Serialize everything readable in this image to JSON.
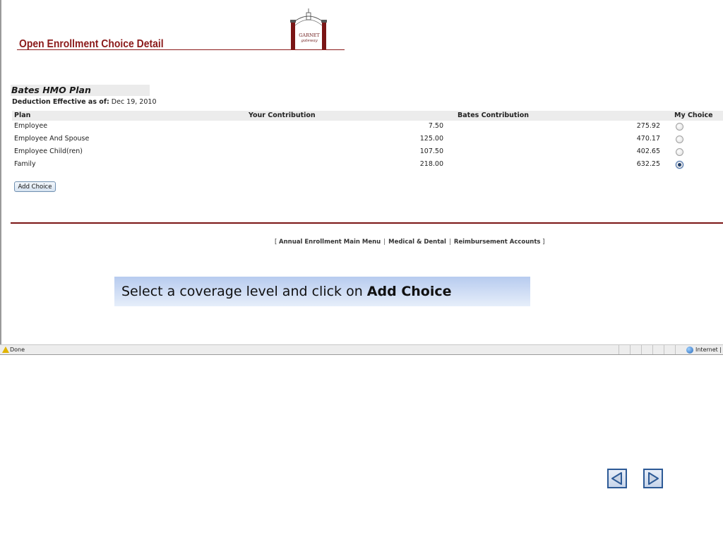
{
  "page": {
    "title": "Open Enrollment Choice Detail",
    "logo_text": "GARNET",
    "logo_sub": "gateway"
  },
  "plan": {
    "name": "Bates HMO Plan",
    "effective_label": "Deduction Effective as of:",
    "effective_date": "Dec 19, 2010",
    "columns": {
      "plan": "Plan",
      "your_contribution": "Your Contribution",
      "bates_contribution": "Bates Contribution",
      "my_choice": "My Choice"
    },
    "rows": [
      {
        "plan": "Employee",
        "your": "7.50",
        "bates": "275.92",
        "selected": false
      },
      {
        "plan": "Employee And Spouse",
        "your": "125.00",
        "bates": "470.17",
        "selected": false
      },
      {
        "plan": "Employee Child(ren)",
        "your": "107.50",
        "bates": "402.65",
        "selected": false
      },
      {
        "plan": "Family",
        "your": "218.00",
        "bates": "632.25",
        "selected": true
      }
    ],
    "add_button": "Add Choice"
  },
  "footer": {
    "open_bracket": "[",
    "close_bracket": "]",
    "links": [
      "Annual Enrollment Main Menu",
      "Medical & Dental",
      "Reimbursement Accounts"
    ],
    "separator": "|"
  },
  "status_bar": {
    "status": "Done",
    "zone": "Internet | Pr"
  },
  "callout": {
    "text": "Select a coverage level and click on ",
    "emphasis": "Add Choice"
  },
  "slides": {
    "accent": "#2d5a96"
  },
  "colors": {
    "title": "#8b1a1a",
    "rule": "#7a1515",
    "callout": "#b7cbef"
  }
}
